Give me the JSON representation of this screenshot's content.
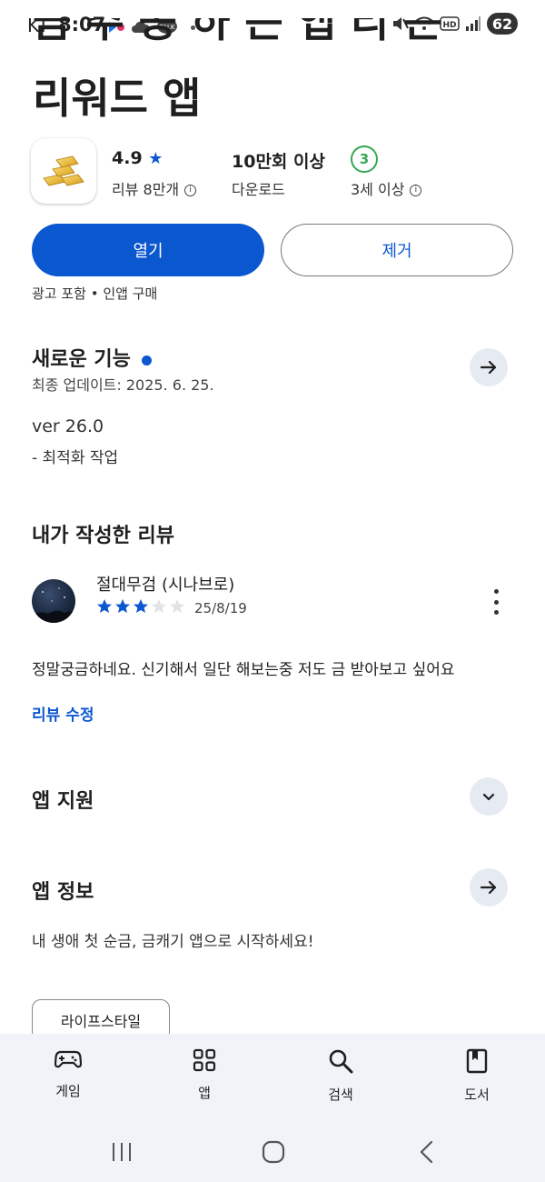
{
  "status_bar": {
    "carrier": "KT",
    "time": "8:07",
    "battery": "62"
  },
  "app": {
    "title_cut": "금 주 공 하 는 앱 리 는",
    "title": "리워드 앱",
    "rating": "4.9",
    "rating_star": "★",
    "reviews": "리뷰 8만개",
    "downloads": "10만회 이상",
    "downloads_label": "다운로드",
    "age_badge": "3",
    "age_label": "3세 이상",
    "icon_name": "gold-bars-icon"
  },
  "actions": {
    "open": "열기",
    "remove": "제거",
    "note": "광고 포함 • 인앱 구매"
  },
  "whats_new": {
    "title": "새로운 기능",
    "updated": "최종 업데이트: 2025. 6. 25.",
    "version": "ver 26.0",
    "notes": "- 최적화 작업"
  },
  "my_review": {
    "title": "내가 작성한 리뷰",
    "author": "절대무검 (시나브로)",
    "rating": 3,
    "max_rating": 5,
    "date": "25/8/19",
    "text": "정말궁금하네요. 신기해서 일단 해보는중 저도 금 받아보고 싶어요",
    "edit_link": "리뷰 수정"
  },
  "app_support": {
    "title": "앱 지원"
  },
  "app_info": {
    "title": "앱 정보",
    "description": "내 생애 첫 순금, 금캐기 앱으로 시작하세요!",
    "category_chip": "라이프스타일"
  },
  "bottom_nav": [
    {
      "label": "게임",
      "icon": "gamepad-icon"
    },
    {
      "label": "앱",
      "icon": "apps-grid-icon"
    },
    {
      "label": "검색",
      "icon": "search-icon"
    },
    {
      "label": "도서",
      "icon": "book-icon"
    }
  ],
  "colors": {
    "accent": "#0b57d0",
    "badge_green": "#34a853",
    "nav_bg": "#f0f4f9"
  }
}
